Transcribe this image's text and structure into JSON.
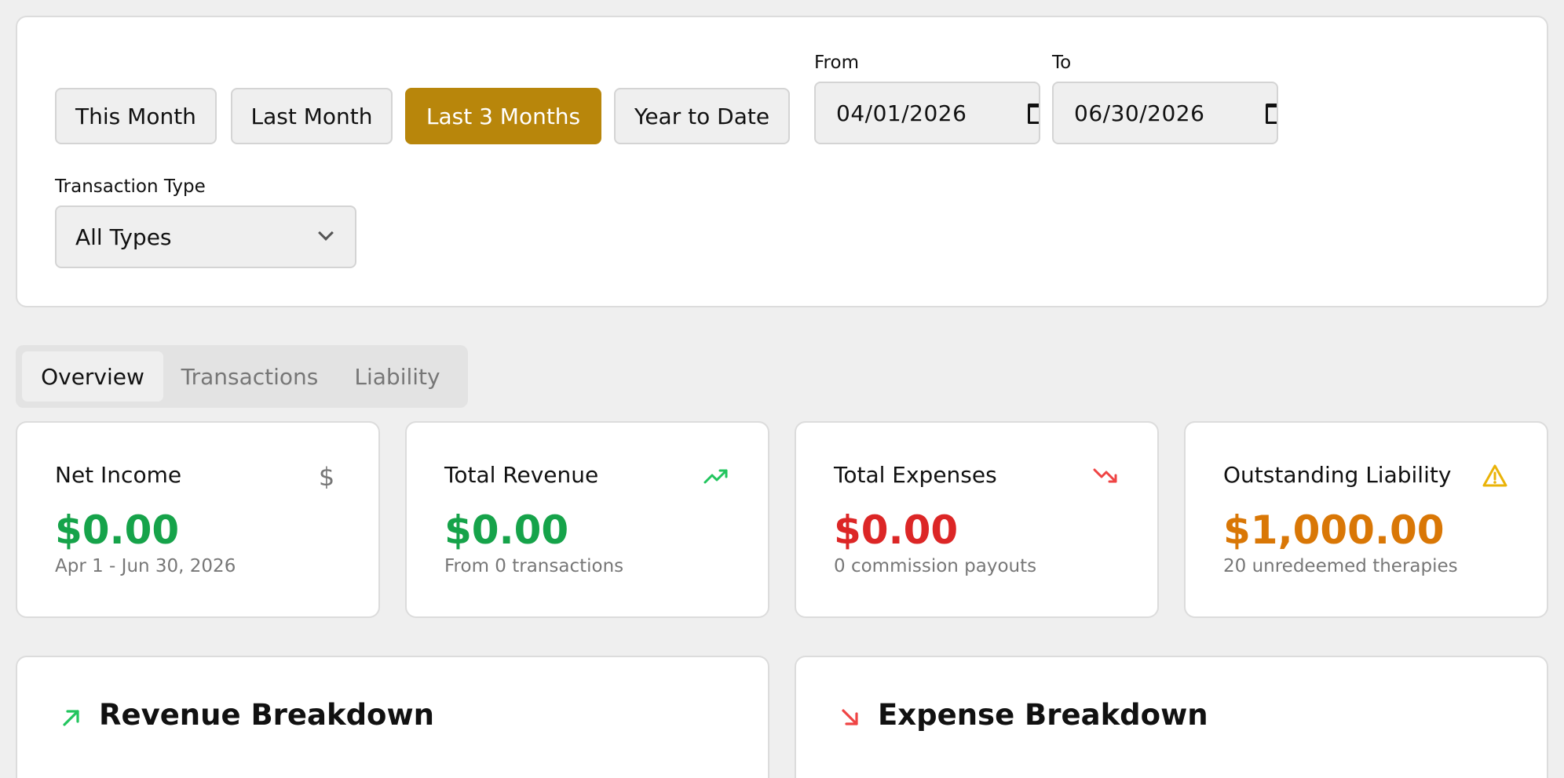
{
  "filters": {
    "presets": [
      "This Month",
      "Last Month",
      "Last 3 Months",
      "Year to Date"
    ],
    "active_preset": "Last 3 Months",
    "from_label": "From",
    "from_value": "04/01/2026",
    "to_label": "To",
    "to_value": "06/30/2026",
    "type_label": "Transaction Type",
    "type_value": "All Types"
  },
  "tabs": [
    "Overview",
    "Transactions",
    "Liability"
  ],
  "active_tab": "Overview",
  "stats": [
    {
      "title": "Net Income",
      "value": "$0.00",
      "sub": "Apr 1 - Jun 30, 2026",
      "icon": "dollar-icon",
      "color": "#16a34a"
    },
    {
      "title": "Total Revenue",
      "value": "$0.00",
      "sub": "From 0 transactions",
      "icon": "trending-up-icon",
      "color": "#16a34a"
    },
    {
      "title": "Total Expenses",
      "value": "$0.00",
      "sub": "0 commission payouts",
      "icon": "trending-down-icon",
      "color": "#dc2626"
    },
    {
      "title": "Outstanding Liability",
      "value": "$1,000.00",
      "sub": "20 unredeemed therapies",
      "icon": "warning-icon",
      "color": "#d97706"
    }
  ],
  "breakdowns": {
    "revenue_title": "Revenue Breakdown",
    "expense_title": "Expense Breakdown"
  },
  "colors": {
    "accent": "#b8860b",
    "positive": "#16a34a",
    "negative": "#dc2626",
    "warning": "#d97706"
  }
}
